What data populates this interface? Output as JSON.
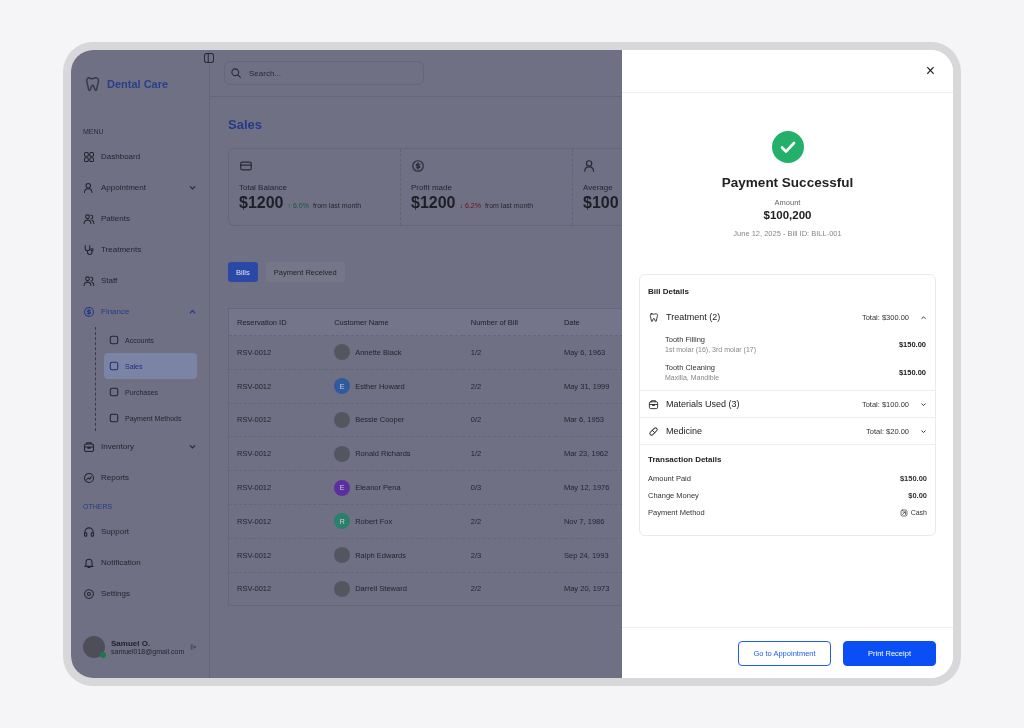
{
  "sidebar": {
    "logo": "Dental Care",
    "sections": [
      {
        "title": "MENU",
        "items": [
          {
            "label": "Dashboard",
            "chevron": false,
            "active": false
          },
          {
            "label": "Appointment",
            "chevron": true,
            "expanded": false,
            "active": false
          },
          {
            "label": "Patients",
            "chevron": false,
            "active": false
          },
          {
            "label": "Treatments",
            "chevron": false,
            "active": false
          },
          {
            "label": "Staff",
            "chevron": false,
            "active": false
          },
          {
            "label": "Finance",
            "chevron": true,
            "expanded": true,
            "active": true,
            "children": [
              {
                "label": "Accounts",
                "selected": false
              },
              {
                "label": "Sales",
                "selected": true
              },
              {
                "label": "Purchases",
                "selected": false
              },
              {
                "label": "Payment Methods",
                "selected": false
              }
            ]
          },
          {
            "label": "Inventory",
            "chevron": true,
            "expanded": false,
            "active": false
          },
          {
            "label": "Reports",
            "chevron": false,
            "active": false
          }
        ]
      },
      {
        "title": "OTHERS",
        "items": [
          {
            "label": "Support",
            "chevron": false,
            "active": false
          },
          {
            "label": "Notification",
            "chevron": false,
            "active": false
          },
          {
            "label": "Settings",
            "chevron": false,
            "active": false
          }
        ]
      }
    ],
    "user": {
      "name": "Samuel O.",
      "email": "samuel018@gmail.com",
      "online": true
    }
  },
  "search": {
    "placeholder": "Search..."
  },
  "page_title": "Sales",
  "stats": [
    {
      "label": "Total Balance",
      "value": "$1200",
      "change": "↑ 6.0%",
      "positive": true,
      "note": "from last month"
    },
    {
      "label": "Profit made",
      "value": "$1200",
      "change": "↓ 6.2%",
      "positive": false,
      "note": "from last month"
    },
    {
      "label": "Average",
      "value": "$100"
    }
  ],
  "tabs": [
    {
      "label": "Bills",
      "selected": true
    },
    {
      "label": "Payment Received",
      "selected": false
    }
  ],
  "table": {
    "columns": [
      "Reservation ID",
      "Customer Name",
      "Number of Bill",
      "Date"
    ],
    "rows": [
      {
        "id": "RSV-0012",
        "avatar": {
          "kind": "photo"
        },
        "name": "Annette Black",
        "bills": "1/2",
        "date": "May 6, 1963"
      },
      {
        "id": "RSV-0012",
        "avatar": {
          "kind": "initial",
          "initial": "E",
          "color": "#2f5a9e"
        },
        "name": "Esther Howard",
        "bills": "2/2",
        "date": "May 31, 1999"
      },
      {
        "id": "RSV-0012",
        "avatar": {
          "kind": "photo"
        },
        "name": "Bessie Cooper",
        "bills": "0/2",
        "date": "Mar 6, 1953"
      },
      {
        "id": "RSV-0012",
        "avatar": {
          "kind": "photo"
        },
        "name": "Ronald Richards",
        "bills": "1/2",
        "date": "Mar 23, 1962"
      },
      {
        "id": "RSV-0012",
        "avatar": {
          "kind": "initial",
          "initial": "E",
          "color": "#5a2fa0"
        },
        "name": "Eleanor Pena",
        "bills": "0/3",
        "date": "May 12, 1976"
      },
      {
        "id": "RSV-0012",
        "avatar": {
          "kind": "initial",
          "initial": "R",
          "color": "#2a8068"
        },
        "name": "Robert Fox",
        "bills": "2/2",
        "date": "Nov 7, 1986"
      },
      {
        "id": "RSV-0012",
        "avatar": {
          "kind": "photo"
        },
        "name": "Ralph Edwards",
        "bills": "2/3",
        "date": "Sep 24, 1993"
      },
      {
        "id": "RSV-0012",
        "avatar": {
          "kind": "photo"
        },
        "name": "Darrell Steward",
        "bills": "2/2",
        "date": "May 20, 1973"
      }
    ]
  },
  "drawer": {
    "close": "×",
    "title": "Payment Successful",
    "amount_label": "Amount",
    "amount": "$100,200",
    "meta": "June 12, 2025 - Bill ID: BILL-001",
    "bill_details": {
      "title": "Bill Details",
      "sections": [
        {
          "title": "Treatment (2)",
          "total": "Total: $300.00",
          "expanded": true,
          "items": [
            {
              "name": "Tooth Filling",
              "detail": "1st molar (16), 3rd molar (17)",
              "price": "$150.00"
            },
            {
              "name": "Tooth Cleaning",
              "detail": "Maxilla, Mandible",
              "price": "$150.00"
            }
          ]
        },
        {
          "title": "Materials Used (3)",
          "total": "Total: $100.00",
          "expanded": false
        },
        {
          "title": "Medicine",
          "total": "Total: $20.00",
          "expanded": false
        }
      ],
      "transaction": {
        "title": "Transaction Details",
        "rows": [
          {
            "label": "Amount Paid",
            "value": "$150.00",
            "kind": "amount"
          },
          {
            "label": "Change Money",
            "value": "$0.00",
            "kind": "amount"
          },
          {
            "label": "Payment Method",
            "value": "Cash",
            "kind": "method"
          }
        ]
      }
    },
    "buttons": [
      {
        "label": "Go to Appointment",
        "kind": "outline"
      },
      {
        "label": "Print Receipt",
        "kind": "primary"
      }
    ]
  }
}
